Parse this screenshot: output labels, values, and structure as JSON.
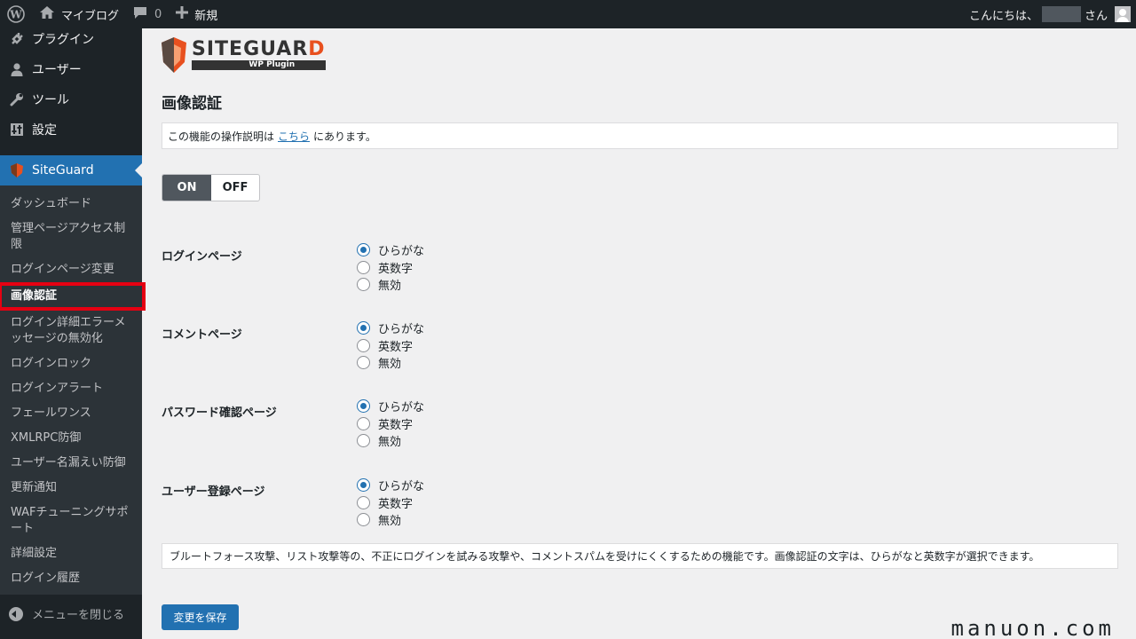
{
  "adminbar": {
    "site_name": "マイブログ",
    "comment_count": "0",
    "new_label": "新規",
    "greeting_prefix": "こんにちは、",
    "greeting_suffix": "さん"
  },
  "sidebar": {
    "top_items": [
      {
        "label": "プラグイン",
        "icon": "plugin-icon"
      },
      {
        "label": "ユーザー",
        "icon": "user-icon"
      },
      {
        "label": "ツール",
        "icon": "wrench-icon"
      },
      {
        "label": "設定",
        "icon": "settings-icon"
      }
    ],
    "current": {
      "label": "SiteGuard",
      "icon": "siteguard-icon"
    },
    "submenu": [
      "ダッシュボード",
      "管理ページアクセス制限",
      "ログインページ変更",
      "画像認証",
      "ログイン詳細エラーメッセージの無効化",
      "ログインロック",
      "ログインアラート",
      "フェールワンス",
      "XMLRPC防御",
      "ユーザー名漏えい防御",
      "更新通知",
      "WAFチューニングサポート",
      "詳細設定",
      "ログイン履歴"
    ],
    "submenu_current_index": 3,
    "collapse_label": "メニューを閉じる"
  },
  "logo": {
    "title_main": "SITEGUAR",
    "title_last": "D",
    "subtitle": "WP Plugin"
  },
  "page": {
    "title": "画像認証",
    "notice_before": "この機能の操作説明は",
    "notice_link": "こちら",
    "notice_after": "にあります。",
    "toggle_on": "ON",
    "toggle_off": "OFF",
    "rows": [
      {
        "label": "ログインページ",
        "options": [
          "ひらがな",
          "英数字",
          "無効"
        ],
        "selected": 0
      },
      {
        "label": "コメントページ",
        "options": [
          "ひらがな",
          "英数字",
          "無効"
        ],
        "selected": 0
      },
      {
        "label": "パスワード確認ページ",
        "options": [
          "ひらがな",
          "英数字",
          "無効"
        ],
        "selected": 0
      },
      {
        "label": "ユーザー登録ページ",
        "options": [
          "ひらがな",
          "英数字",
          "無効"
        ],
        "selected": 0
      }
    ],
    "description": "ブルートフォース攻撃、リスト攻撃等の、不正にログインを試みる攻撃や、コメントスパムを受けにくくするための機能です。画像認証の文字は、ひらがなと英数字が選択できます。",
    "save_label": "変更を保存"
  },
  "watermark": "manuon.com",
  "colors": {
    "accent": "#2271b1",
    "highlight_box": "#e60012",
    "adminbar_bg": "#1d2327"
  }
}
